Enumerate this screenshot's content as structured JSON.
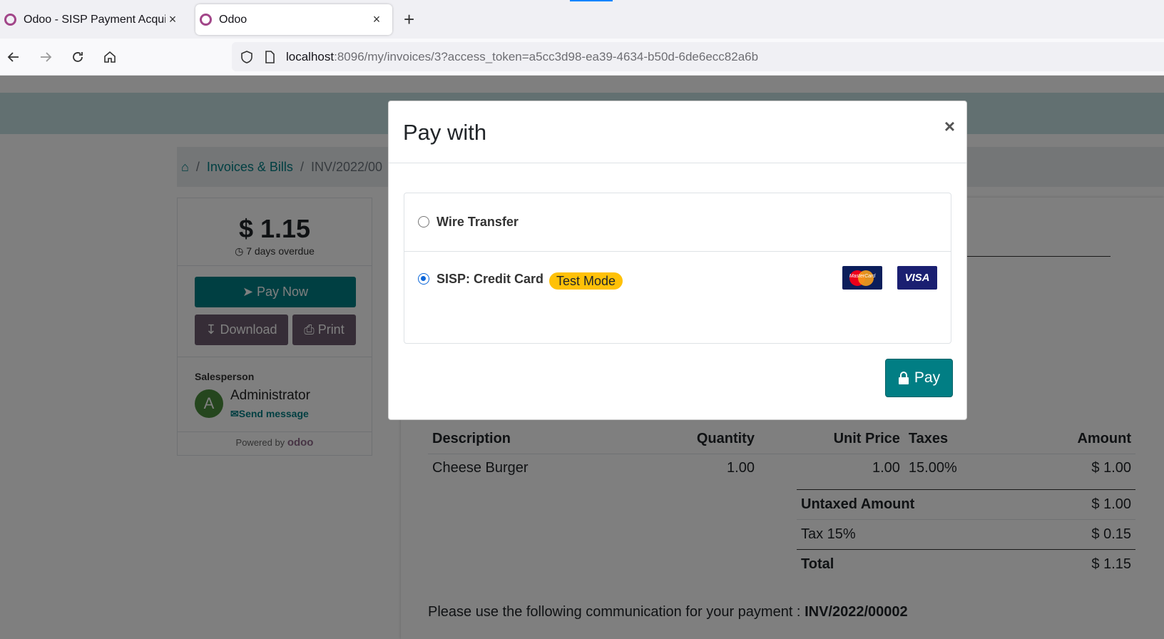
{
  "browser": {
    "tabs": [
      {
        "title": "Odoo - SISP Payment Acquirer",
        "active": false
      },
      {
        "title": "Odoo",
        "active": true
      }
    ],
    "new_tab_label": "+",
    "tab_close": "×",
    "url_host": "localhost",
    "url_rest": ":8096/my/invoices/3?access_token=a5cc3d98-ea39-4634-b50d-6de6ecc82a6b"
  },
  "breadcrumb": {
    "sep": "/",
    "invoices": "Invoices & Bills",
    "current": "INV/2022/00"
  },
  "sidebar": {
    "amount": "$ 1.15",
    "overdue": "7 days overdue",
    "pay_now": "Pay Now",
    "download": "Download",
    "print": "Print",
    "salesperson_label": "Salesperson",
    "avatar_letter": "A",
    "salesperson_name": "Administrator",
    "send_message": "Send message",
    "powered_by": "Powered by",
    "odoo": "odoo"
  },
  "invoice": {
    "headers": {
      "description": "Description",
      "quantity": "Quantity",
      "unit_price": "Unit Price",
      "taxes": "Taxes",
      "amount": "Amount"
    },
    "lines": [
      {
        "description": "Cheese Burger",
        "quantity": "1.00",
        "unit_price": "1.00",
        "taxes": "15.00%",
        "amount": "$ 1.00"
      }
    ],
    "totals": {
      "untaxed_label": "Untaxed Amount",
      "untaxed_value": "$ 1.00",
      "tax_label": "Tax 15%",
      "tax_value": "$ 0.15",
      "total_label": "Total",
      "total_value": "$ 1.15"
    },
    "communication_text": "Please use the following communication for your payment :",
    "communication_ref": "INV/2022/00002"
  },
  "modal": {
    "title": "Pay with",
    "close": "×",
    "methods": [
      {
        "label": "Wire Transfer",
        "selected": false
      },
      {
        "label": "SISP: Credit Card",
        "selected": true,
        "badge": "Test Mode"
      }
    ],
    "cards": {
      "mastercard": "MasterCard",
      "visa": "VISA"
    },
    "pay_button": "Pay"
  },
  "colors": {
    "primary": "#017e84",
    "secondary": "#6c5a6e",
    "badge": "#ffc107",
    "radio_selected": "#0a66d9"
  }
}
